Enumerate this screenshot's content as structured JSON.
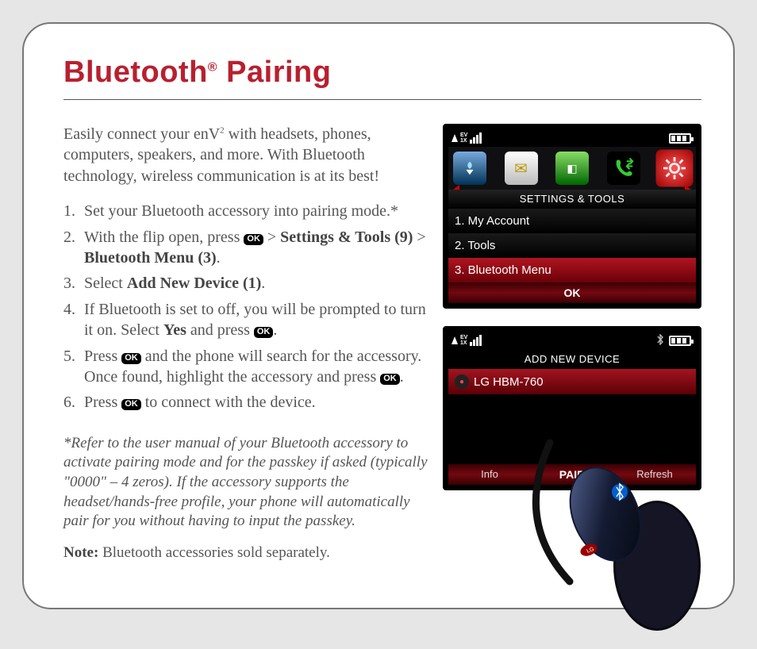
{
  "title_pre": "Bluetooth",
  "title_sup": "®",
  "title_post": " Pairing",
  "intro_a": "Easily connect your enV",
  "intro_sup": "2",
  "intro_b": " with headsets, phones, computers, speakers, and more. With Bluetooth technology, wireless communication is at its best!",
  "steps": {
    "s1": "Set your Bluetooth accessory into pairing mode.*",
    "s2a": "With the flip open, press ",
    "s2b": " > ",
    "s2c": "Settings & Tools (9)",
    "s2d": " > ",
    "s2e": "Bluetooth Menu (3)",
    "s2f": ".",
    "s3a": "Select ",
    "s3b": "Add New Device (1)",
    "s3c": ".",
    "s4a": "If Bluetooth is set to off, you will be prompted to turn it on. Select ",
    "s4b": "Yes",
    "s4c": " and press ",
    "s4d": ".",
    "s5a": "Press ",
    "s5b": " and the phone will search for the accessory. Once found, highlight the accessory and press ",
    "s5c": ".",
    "s6a": "Press ",
    "s6b": " to connect with the device."
  },
  "ok_label": "OK",
  "footnote": "*Refer to the user manual of your Bluetooth accessory to activate pairing mode and for the passkey if asked (typically \"0000\" – 4 zeros). If the accessory supports the headset/hands-free profile, your phone will automatically pair for you without having to input the passkey.",
  "note_b": "Note:",
  "note_t": " Bluetooth accessories sold separately.",
  "screen1": {
    "section": "SETTINGS & TOOLS",
    "items": [
      "1. My Account",
      "2. Tools",
      "3. Bluetooth Menu"
    ],
    "softcenter": "OK"
  },
  "screen2": {
    "title": "ADD NEW DEVICE",
    "device": "LG HBM-760",
    "soft_left": "Info",
    "soft_center": "PAIR",
    "soft_right": "Refresh"
  },
  "status": {
    "ev": "EV",
    "one": "1X"
  }
}
